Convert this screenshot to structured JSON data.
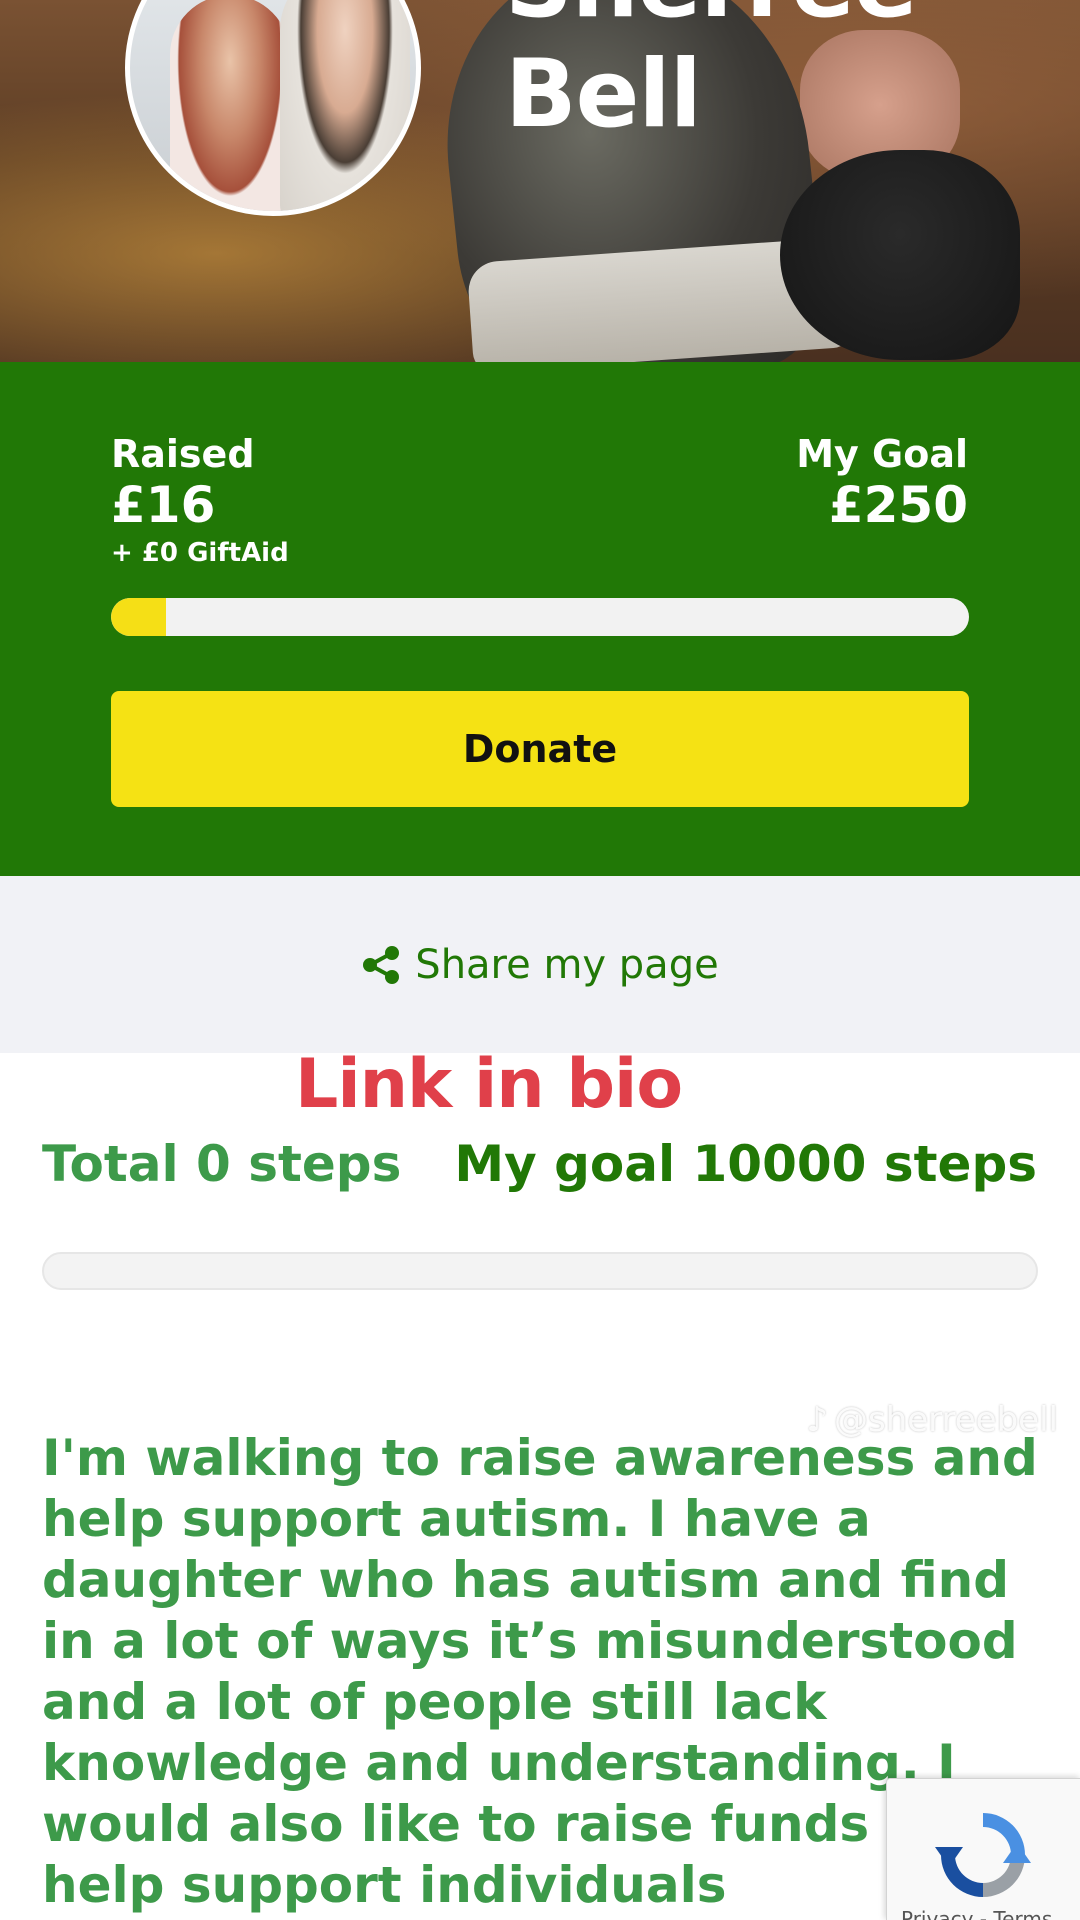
{
  "profile": {
    "name_line1": "Sherree",
    "name_line2": "Bell"
  },
  "fundraising": {
    "raised_label": "Raised",
    "raised_amount": "£16",
    "giftaid": "+ £0 GiftAid",
    "goal_label": "My Goal",
    "goal_amount": "£250",
    "progress_fraction": 0.064,
    "donate_label": "Donate"
  },
  "share": {
    "label": "Share my page",
    "icon": "share-icon"
  },
  "overlay": {
    "link_in_bio": "Link in bio",
    "watermark": "@sherreebell"
  },
  "steps": {
    "total_label": "Total 0 steps",
    "goal_label": "My goal 10000 steps",
    "progress_fraction": 0
  },
  "story": {
    "text": "I'm walking to raise awareness and help support autism. I have a daughter who has autism and find in a lot of ways it’s misunderstood and a lot of people still lack knowledge and understanding. I would also like to raise funds to help support individuals"
  },
  "recaptcha": {
    "terms": "Privacy - Terms"
  },
  "colors": {
    "brand_green": "#217806",
    "text_green": "#3d9a4a",
    "donate_yellow": "#f5e214",
    "progress_yellow": "#f5df16",
    "link_red": "#e0404a",
    "share_bg": "#f1f2f6"
  }
}
